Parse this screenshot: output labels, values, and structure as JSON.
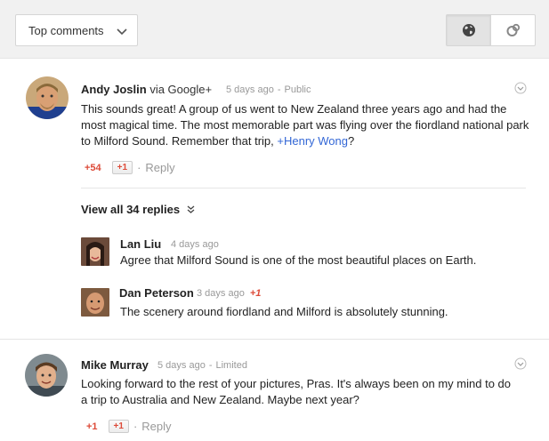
{
  "toolbar": {
    "sort_label": "Top comments",
    "icons": {
      "sort_chevron": "chevron-down-icon",
      "public": "globe-icon",
      "circles": "circles-icon"
    }
  },
  "comments": [
    {
      "author": "Andy Joslin",
      "via": "via Google+",
      "time": "5 days ago",
      "separator": "-",
      "visibility": "Public",
      "text_before": "This sounds great! A group of us went to New Zealand three years ago and had the most magical time. The most memorable part was flying over the fiordland national park to Milford Sound. Remember that trip, ",
      "mention": "+Henry Wong",
      "text_after": "?",
      "plus_count": "+54",
      "plus_button": "+1",
      "dot": "·",
      "reply": "Reply",
      "view_all": "View all 34 replies",
      "replies": [
        {
          "author": "Lan Liu",
          "time": "4 days ago",
          "plus": "",
          "text": "Agree that Milford Sound is one of the most beautiful places on Earth."
        },
        {
          "author": "Dan Peterson",
          "time": "3 days ago",
          "plus": "+1",
          "text": "The scenery around fiordland and Milford is absolutely stunning."
        }
      ]
    },
    {
      "author": "Mike Murray",
      "time": "5 days ago",
      "separator": "-",
      "visibility": "Limited",
      "text": "Looking forward to the rest of your pictures, Pras. It's always been on my mind to do a trip to Australia and New Zealand. Maybe next year?",
      "plus_count": "+1",
      "plus_button": "+1",
      "dot": "·",
      "reply": "Reply"
    }
  ],
  "colors": {
    "accent_red": "#dd4b39",
    "link_blue": "#3367d6",
    "toolbar_bg": "#f1f1f1"
  }
}
